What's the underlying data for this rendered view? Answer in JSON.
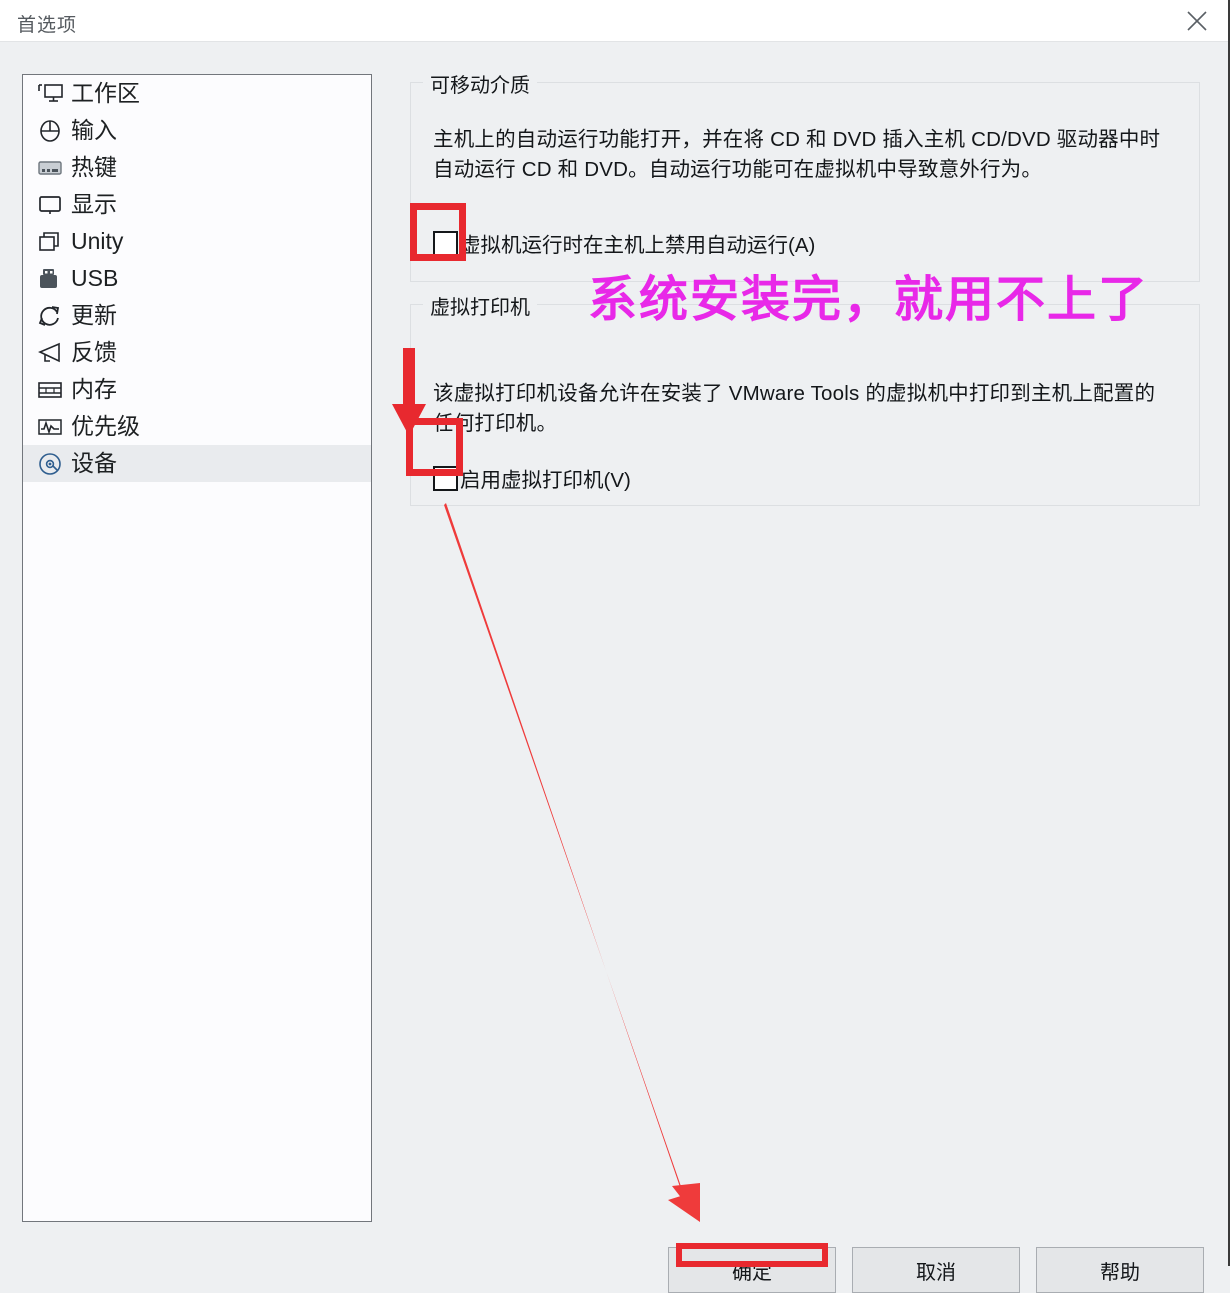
{
  "window": {
    "title": "首选项",
    "close_icon": "close-icon"
  },
  "sidebar": {
    "items": [
      {
        "label": "工作区",
        "icon": "workspace-icon",
        "selected": false
      },
      {
        "label": "输入",
        "icon": "mouse-input-icon",
        "selected": false
      },
      {
        "label": "热键",
        "icon": "keyboard-hotkey-icon",
        "selected": false
      },
      {
        "label": "显示",
        "icon": "monitor-display-icon",
        "selected": false
      },
      {
        "label": "Unity",
        "icon": "unity-windows-icon",
        "selected": false
      },
      {
        "label": "USB",
        "icon": "usb-drive-icon",
        "selected": false
      },
      {
        "label": "更新",
        "icon": "refresh-update-icon",
        "selected": false
      },
      {
        "label": "反馈",
        "icon": "megaphone-feedback-icon",
        "selected": false
      },
      {
        "label": "内存",
        "icon": "memory-ram-icon",
        "selected": false
      },
      {
        "label": "优先级",
        "icon": "priority-graph-icon",
        "selected": false
      },
      {
        "label": "设备",
        "icon": "disc-device-icon",
        "selected": true
      }
    ]
  },
  "panels": {
    "removable_media": {
      "legend": "可移动介质",
      "description": "主机上的自动运行功能打开，并在将 CD 和 DVD 插入主机 CD/DVD 驱动器中时自动运行 CD 和 DVD。自动运行功能可在虚拟机中导致意外行为。",
      "checkbox_label": "虚拟机运行时在主机上禁用自动运行(A)",
      "checked": false
    },
    "virtual_printer": {
      "legend": "虚拟打印机",
      "description": "该虚拟打印机设备允许在安装了 VMware Tools 的虚拟机中打印到主机上配置的任何打印机。",
      "checkbox_label": "启用虚拟打印机(V)",
      "checked": false
    }
  },
  "buttons": {
    "ok": "确定",
    "cancel": "取消",
    "help": "帮助"
  },
  "annotations": {
    "note_text": "系统安装完，就用不上了",
    "note_color": "#e828e8",
    "marker_color": "#e8292f"
  }
}
